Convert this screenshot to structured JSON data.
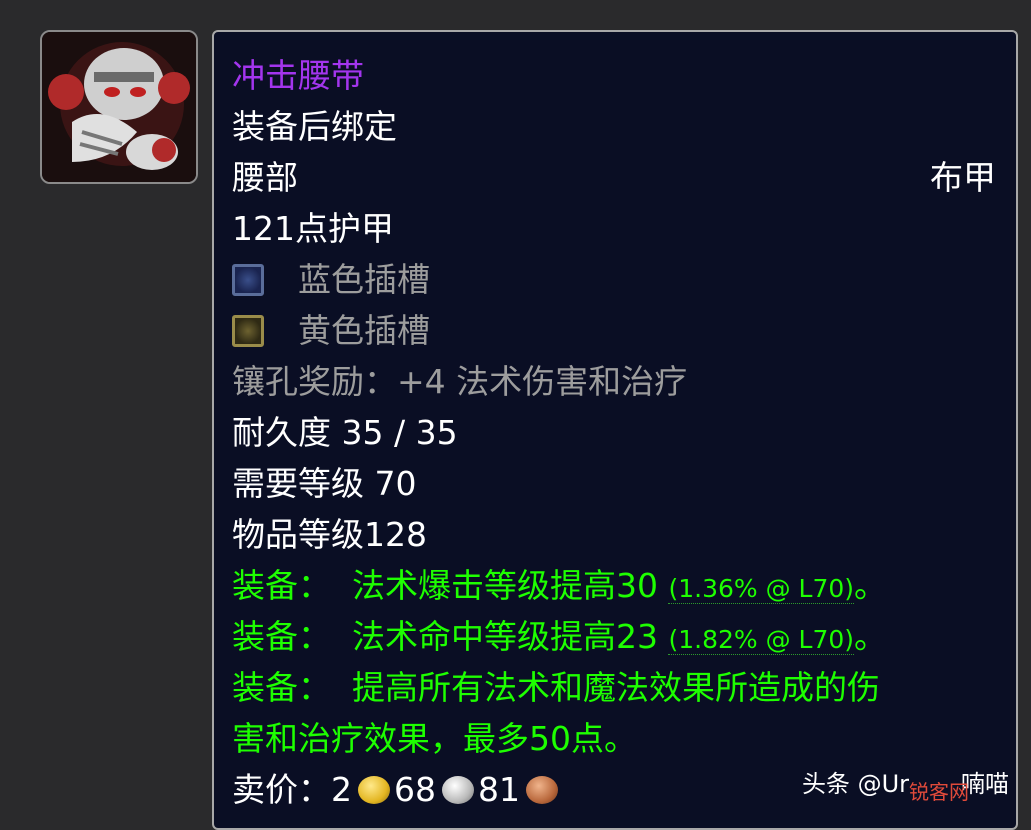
{
  "item": {
    "name": "冲击腰带",
    "bind": "装备后绑定",
    "slot": "腰部",
    "type": "布甲",
    "armor": "121点护甲",
    "sockets": [
      {
        "color": "blue",
        "label": "蓝色插槽"
      },
      {
        "color": "yellow",
        "label": "黄色插槽"
      }
    ],
    "socket_bonus": "镶孔奖励：+4 法术伤害和治疗",
    "durability": "耐久度 35 / 35",
    "required_level": "需要等级 70",
    "item_level": "物品等级128",
    "equip": [
      {
        "prefix": "装备：",
        "text": "法术爆击等级提高30",
        "note": "(1.36% @ L70)",
        "suffix": "。"
      },
      {
        "prefix": "装备：",
        "text": "法术命中等级提高23",
        "note": "(1.82% @ L70)",
        "suffix": "。"
      },
      {
        "prefix": "装备：",
        "text": "提高所有法术和魔法效果所造成的伤",
        "text2": "害和治疗效果，最多50点。"
      }
    ],
    "sell_label": "卖价：",
    "sell_gold": "2",
    "sell_silver": "68",
    "sell_copper": "81"
  },
  "watermark": {
    "text": "头条 @Ur",
    "text_end": "喃喵",
    "overlay": "锐客网"
  },
  "colors": {
    "epic": "#a335ee",
    "green": "#1eff00",
    "gray": "#9d9d9d",
    "background": "#0a0e24"
  }
}
